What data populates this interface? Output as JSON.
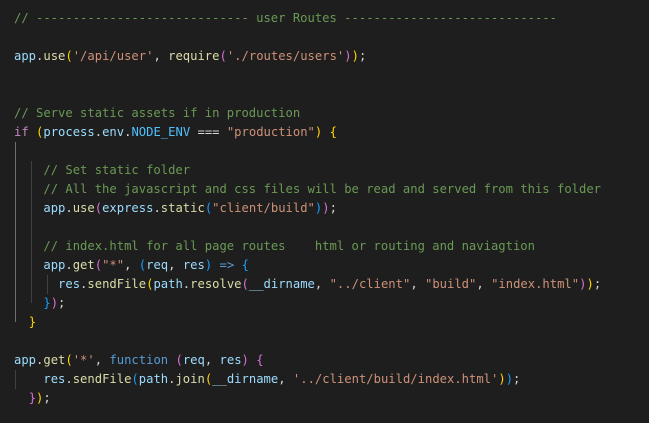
{
  "colors": {
    "background": "#1e1e1e",
    "default": "#d4d4d4",
    "comment": "#6a9955",
    "variable": "#9cdcfe",
    "function": "#dcdcaa",
    "string": "#ce9178",
    "keyword_control": "#c586c0",
    "keyword": "#569cd6",
    "constant": "#4fc1ff",
    "bracket_gold": "#ffd700",
    "bracket_purple": "#da70d6",
    "bracket_blue": "#179fff",
    "indent_guide": "#404040"
  },
  "lines": [
    [
      {
        "t": "// ----------------------------- user Routes -----------------------------",
        "c": "comment"
      }
    ],
    [],
    [
      {
        "t": "app",
        "c": "variable"
      },
      {
        "t": ".",
        "c": "default"
      },
      {
        "t": "use",
        "c": "function"
      },
      {
        "t": "(",
        "c": "bracket_gold"
      },
      {
        "t": "'/api/user'",
        "c": "string"
      },
      {
        "t": ", ",
        "c": "default"
      },
      {
        "t": "require",
        "c": "function"
      },
      {
        "t": "(",
        "c": "bracket_purple"
      },
      {
        "t": "'./routes/users'",
        "c": "string"
      },
      {
        "t": ")",
        "c": "bracket_purple"
      },
      {
        "t": ")",
        "c": "bracket_gold"
      },
      {
        "t": ";",
        "c": "default"
      }
    ],
    [],
    [],
    [
      {
        "t": "// Serve static assets if in production",
        "c": "comment"
      }
    ],
    [
      {
        "t": "if",
        "c": "keyword_control"
      },
      {
        "t": " ",
        "c": "default"
      },
      {
        "t": "(",
        "c": "bracket_gold"
      },
      {
        "t": "process",
        "c": "variable"
      },
      {
        "t": ".",
        "c": "default"
      },
      {
        "t": "env",
        "c": "variable"
      },
      {
        "t": ".",
        "c": "default"
      },
      {
        "t": "NODE_ENV",
        "c": "constant"
      },
      {
        "t": " === ",
        "c": "default"
      },
      {
        "t": "\"production\"",
        "c": "string"
      },
      {
        "t": ")",
        "c": "bracket_gold"
      },
      {
        "t": " ",
        "c": "default"
      },
      {
        "t": "{",
        "c": "bracket_gold"
      }
    ],
    [],
    [
      {
        "t": "    ",
        "c": "default"
      },
      {
        "t": "// Set static folder",
        "c": "comment"
      }
    ],
    [
      {
        "t": "    ",
        "c": "default"
      },
      {
        "t": "// All the javascript and css files will be read and served from this folder",
        "c": "comment"
      }
    ],
    [
      {
        "t": "    ",
        "c": "default"
      },
      {
        "t": "app",
        "c": "variable"
      },
      {
        "t": ".",
        "c": "default"
      },
      {
        "t": "use",
        "c": "function"
      },
      {
        "t": "(",
        "c": "bracket_purple"
      },
      {
        "t": "express",
        "c": "variable"
      },
      {
        "t": ".",
        "c": "default"
      },
      {
        "t": "static",
        "c": "function"
      },
      {
        "t": "(",
        "c": "bracket_blue"
      },
      {
        "t": "\"client/build\"",
        "c": "string"
      },
      {
        "t": ")",
        "c": "bracket_blue"
      },
      {
        "t": ")",
        "c": "bracket_purple"
      },
      {
        "t": ";",
        "c": "default"
      }
    ],
    [],
    [
      {
        "t": "    ",
        "c": "default"
      },
      {
        "t": "// index.html for all page routes    html or routing and naviagtion",
        "c": "comment"
      }
    ],
    [
      {
        "t": "    ",
        "c": "default"
      },
      {
        "t": "app",
        "c": "variable"
      },
      {
        "t": ".",
        "c": "default"
      },
      {
        "t": "get",
        "c": "function"
      },
      {
        "t": "(",
        "c": "bracket_purple"
      },
      {
        "t": "\"*\"",
        "c": "string"
      },
      {
        "t": ", ",
        "c": "default"
      },
      {
        "t": "(",
        "c": "bracket_blue"
      },
      {
        "t": "req",
        "c": "variable"
      },
      {
        "t": ", ",
        "c": "default"
      },
      {
        "t": "res",
        "c": "variable"
      },
      {
        "t": ")",
        "c": "bracket_blue"
      },
      {
        "t": " ",
        "c": "default"
      },
      {
        "t": "=>",
        "c": "keyword"
      },
      {
        "t": " ",
        "c": "default"
      },
      {
        "t": "{",
        "c": "bracket_blue"
      }
    ],
    [
      {
        "t": "      ",
        "c": "default"
      },
      {
        "t": "res",
        "c": "variable"
      },
      {
        "t": ".",
        "c": "default"
      },
      {
        "t": "sendFile",
        "c": "function"
      },
      {
        "t": "(",
        "c": "bracket_gold"
      },
      {
        "t": "path",
        "c": "variable"
      },
      {
        "t": ".",
        "c": "default"
      },
      {
        "t": "resolve",
        "c": "function"
      },
      {
        "t": "(",
        "c": "bracket_purple"
      },
      {
        "t": "__dirname",
        "c": "variable"
      },
      {
        "t": ", ",
        "c": "default"
      },
      {
        "t": "\"../client\"",
        "c": "string"
      },
      {
        "t": ", ",
        "c": "default"
      },
      {
        "t": "\"build\"",
        "c": "string"
      },
      {
        "t": ", ",
        "c": "default"
      },
      {
        "t": "\"index.html\"",
        "c": "string"
      },
      {
        "t": ")",
        "c": "bracket_purple"
      },
      {
        "t": ")",
        "c": "bracket_gold"
      },
      {
        "t": ";",
        "c": "default"
      }
    ],
    [
      {
        "t": "    ",
        "c": "default"
      },
      {
        "t": "}",
        "c": "bracket_blue"
      },
      {
        "t": ")",
        "c": "bracket_purple"
      },
      {
        "t": ";",
        "c": "default"
      }
    ],
    [
      {
        "t": "  ",
        "c": "default"
      },
      {
        "t": "}",
        "c": "bracket_gold"
      }
    ],
    [],
    [
      {
        "t": "app",
        "c": "variable"
      },
      {
        "t": ".",
        "c": "default"
      },
      {
        "t": "get",
        "c": "function"
      },
      {
        "t": "(",
        "c": "bracket_gold"
      },
      {
        "t": "'*'",
        "c": "string"
      },
      {
        "t": ", ",
        "c": "default"
      },
      {
        "t": "function",
        "c": "keyword"
      },
      {
        "t": " ",
        "c": "default"
      },
      {
        "t": "(",
        "c": "bracket_purple"
      },
      {
        "t": "req",
        "c": "variable"
      },
      {
        "t": ", ",
        "c": "default"
      },
      {
        "t": "res",
        "c": "variable"
      },
      {
        "t": ")",
        "c": "bracket_purple"
      },
      {
        "t": " ",
        "c": "default"
      },
      {
        "t": "{",
        "c": "bracket_purple"
      }
    ],
    [
      {
        "t": "    ",
        "c": "default"
      },
      {
        "t": "res",
        "c": "variable"
      },
      {
        "t": ".",
        "c": "default"
      },
      {
        "t": "sendFile",
        "c": "function"
      },
      {
        "t": "(",
        "c": "bracket_blue"
      },
      {
        "t": "path",
        "c": "variable"
      },
      {
        "t": ".",
        "c": "default"
      },
      {
        "t": "join",
        "c": "function"
      },
      {
        "t": "(",
        "c": "bracket_gold"
      },
      {
        "t": "__dirname",
        "c": "variable"
      },
      {
        "t": ", ",
        "c": "default"
      },
      {
        "t": "'../client/build/index.html'",
        "c": "string"
      },
      {
        "t": ")",
        "c": "bracket_gold"
      },
      {
        "t": ")",
        "c": "bracket_blue"
      },
      {
        "t": ";",
        "c": "default"
      }
    ],
    [
      {
        "t": "  ",
        "c": "default"
      },
      {
        "t": "}",
        "c": "bracket_purple"
      },
      {
        "t": ")",
        "c": "bracket_gold"
      },
      {
        "t": ";",
        "c": "default"
      }
    ]
  ]
}
